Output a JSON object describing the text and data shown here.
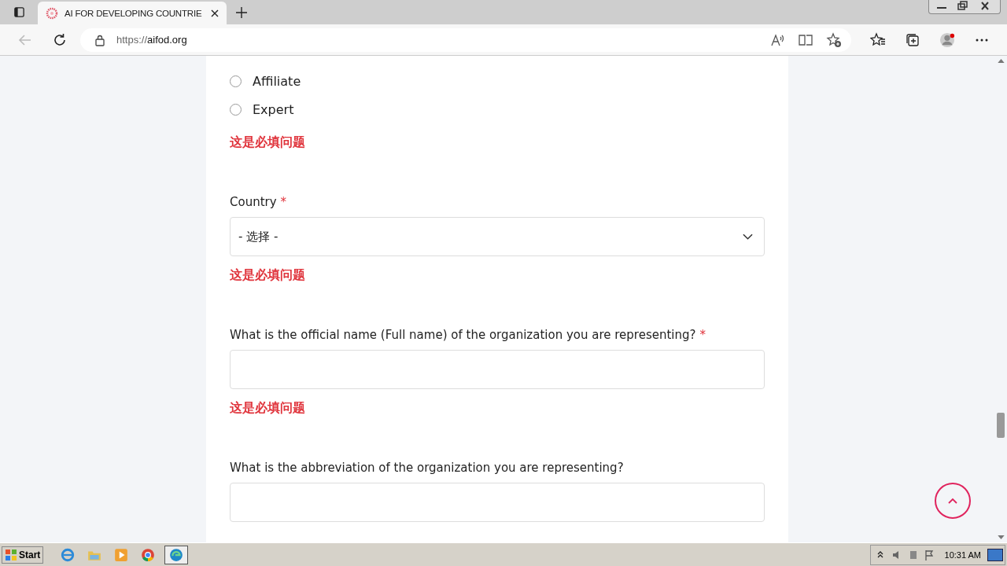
{
  "browser": {
    "tab_title": "AI FOR DEVELOPING COUNTRIE",
    "url_prefix": "https://",
    "url_domain": "aifod.org"
  },
  "form": [
    {
      "kind": "radio",
      "options": [
        {
          "label": "Affiliate",
          "selected": false
        },
        {
          "label": "Expert",
          "selected": false
        }
      ],
      "error": "这是必填问题"
    },
    {
      "kind": "select",
      "label": "Country",
      "required": true,
      "value": "- 选择 -",
      "error": "这是必填问题"
    },
    {
      "kind": "text",
      "label": "What is the official name (Full name) of the organization you are representing?",
      "required": true,
      "error": "这是必填问题"
    },
    {
      "kind": "text",
      "label": "What is the abbreviation of the organization you are representing?",
      "required": false
    }
  ],
  "required_mark": "*",
  "taskbar": {
    "start": "Start",
    "time": "10:31 AM"
  }
}
